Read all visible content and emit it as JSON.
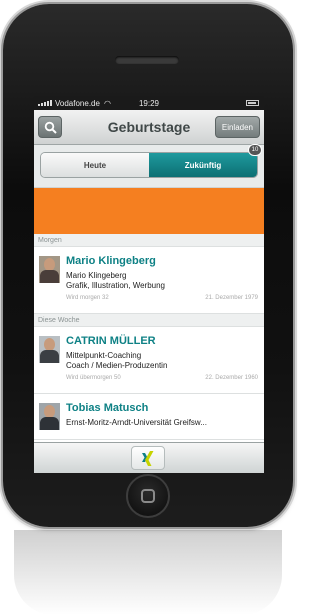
{
  "statusbar": {
    "carrier": "Vodafone.de",
    "time": "19:29",
    "icons": [
      "signal-icon",
      "wifi-icon",
      "battery-icon"
    ]
  },
  "navbar": {
    "title": "Geburtstage",
    "invite_label": "Einladen",
    "search_icon": "search-icon"
  },
  "segments": {
    "today_label": "Heute",
    "future_label": "Zukünftig",
    "future_badge": "10"
  },
  "banner": {
    "color": "#f57f20"
  },
  "sections": [
    {
      "header": "Morgen",
      "items": [
        {
          "name": "Mario Klingeberg",
          "line1": "Mario Klingeberg",
          "line2": "Grafik, Illustration, Werbung",
          "when": "Wird morgen 32",
          "date": "21. Dezember 1979"
        }
      ]
    },
    {
      "header": "Diese Woche",
      "items": [
        {
          "name": "CATRIN MÜLLER",
          "line1": "Mittelpunkt-Coaching",
          "line2": "Coach / Medien-Produzentin",
          "when": "Wird übermorgen 50",
          "date": "22. Dezember 1960"
        },
        {
          "name": "Tobias Matusch",
          "line1": "Ernst-Moritz-Arndt-Universität Greifsw...",
          "line2": "",
          "when": "",
          "date": ""
        }
      ]
    }
  ],
  "tabbar": {
    "logo_icon": "xing-logo-icon"
  },
  "colors": {
    "accent": "#0e8185",
    "segment_active": "#12878b",
    "banner": "#f57f20"
  }
}
